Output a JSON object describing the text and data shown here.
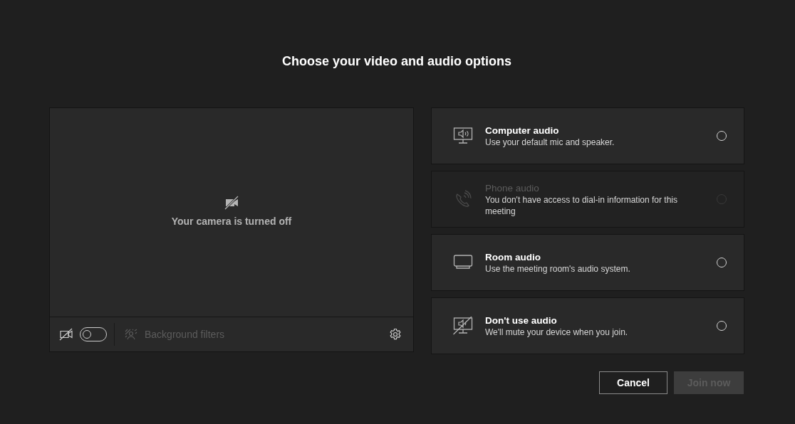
{
  "title": "Choose your video and audio options",
  "video": {
    "message": "Your camera is turned off",
    "camera_on": false,
    "background_filters": {
      "label": "Background filters",
      "disabled": true
    }
  },
  "audio_options": [
    {
      "kind": "computer",
      "title": "Computer audio",
      "description": "Use your default mic and speaker.",
      "selected": false,
      "disabled": false
    },
    {
      "kind": "phone",
      "title": "Phone audio",
      "description": "You don't have access to dial-in information for this meeting",
      "selected": false,
      "disabled": true
    },
    {
      "kind": "room",
      "title": "Room audio",
      "description": "Use the meeting room's audio system.",
      "selected": false,
      "disabled": false
    },
    {
      "kind": "none",
      "title": "Don't use audio",
      "description": "We'll mute your device when you join.",
      "selected": false,
      "disabled": false
    }
  ],
  "buttons": [
    {
      "label": "Cancel",
      "kind": "secondary",
      "disabled": false
    },
    {
      "label": "Join now",
      "kind": "primary",
      "disabled": true
    }
  ]
}
